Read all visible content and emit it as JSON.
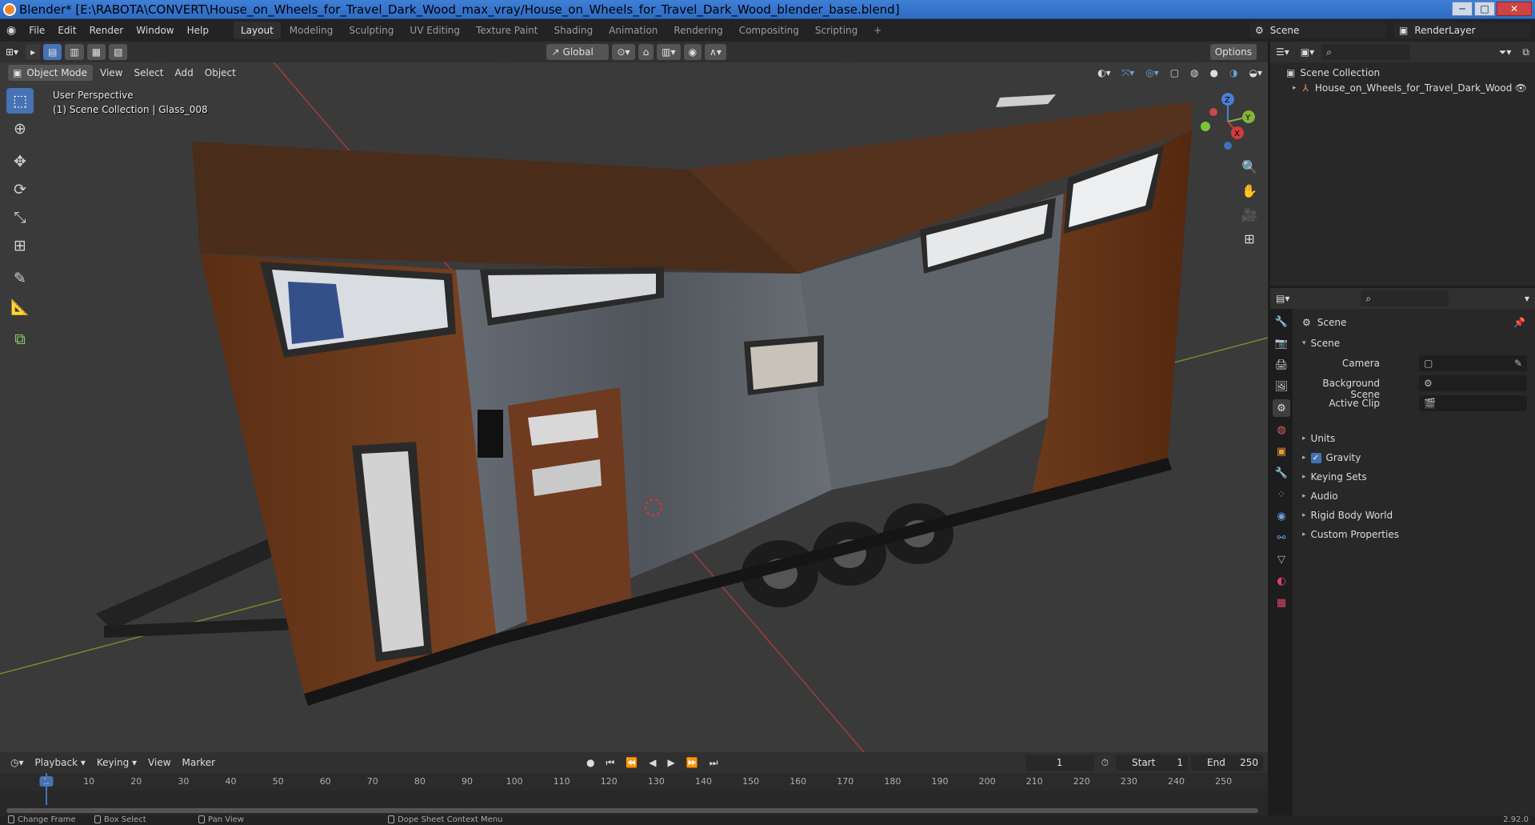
{
  "window": {
    "title": "Blender* [E:\\RABOTA\\CONVERT\\House_on_Wheels_for_Travel_Dark_Wood_max_vray/House_on_Wheels_for_Travel_Dark_Wood_blender_base.blend]",
    "min": "─",
    "max": "□",
    "close": "✕"
  },
  "menubar": [
    "File",
    "Edit",
    "Render",
    "Window",
    "Help"
  ],
  "workspaces": {
    "active": "Layout",
    "tabs": [
      "Layout",
      "Modeling",
      "Sculpting",
      "UV Editing",
      "Texture Paint",
      "Shading",
      "Animation",
      "Rendering",
      "Compositing",
      "Scripting"
    ],
    "add": "+"
  },
  "scene_selector": {
    "value": "Scene"
  },
  "layer_selector": {
    "value": "RenderLayer"
  },
  "tool_header": {
    "orientation": "Global",
    "options": "Options"
  },
  "viewport_header": {
    "mode": "Object Mode",
    "menus": [
      "View",
      "Select",
      "Add",
      "Object"
    ]
  },
  "viewport_info": {
    "line1": "User Perspective",
    "line2": "(1) Scene Collection | Glass_008"
  },
  "gizmo": {
    "x": "X",
    "y": "Y",
    "z": "Z"
  },
  "outliner": {
    "root": "Scene Collection",
    "items": [
      "House_on_Wheels_for_Travel_Dark_Wood"
    ]
  },
  "properties": {
    "context_title": "Scene",
    "panel_title": "Scene",
    "fields": [
      {
        "label": "Camera",
        "value": ""
      },
      {
        "label": "Background Scene",
        "value": ""
      },
      {
        "label": "Active Clip",
        "value": ""
      }
    ],
    "sections": [
      "Units",
      "Gravity",
      "Keying Sets",
      "Audio",
      "Rigid Body World",
      "Custom Properties"
    ],
    "gravity_checked": true
  },
  "timeline": {
    "menus": [
      "Playback",
      "Keying",
      "View",
      "Marker"
    ],
    "current_frame": "1",
    "start_label": "Start",
    "start": "1",
    "end_label": "End",
    "end": "250",
    "ticks": [
      "1",
      "10",
      "20",
      "30",
      "40",
      "50",
      "60",
      "70",
      "80",
      "90",
      "100",
      "110",
      "120",
      "130",
      "140",
      "150",
      "160",
      "170",
      "180",
      "190",
      "200",
      "210",
      "220",
      "230",
      "240",
      "250"
    ]
  },
  "statusbar": {
    "items": [
      "Change Frame",
      "Box Select",
      "Pan View",
      "Dope Sheet Context Menu"
    ],
    "version": "2.92.0"
  },
  "colors": {
    "accent": "#4772b3",
    "wood": "#6b3a1c",
    "siding": "#5b6068",
    "roof": "#4a2c1a"
  }
}
